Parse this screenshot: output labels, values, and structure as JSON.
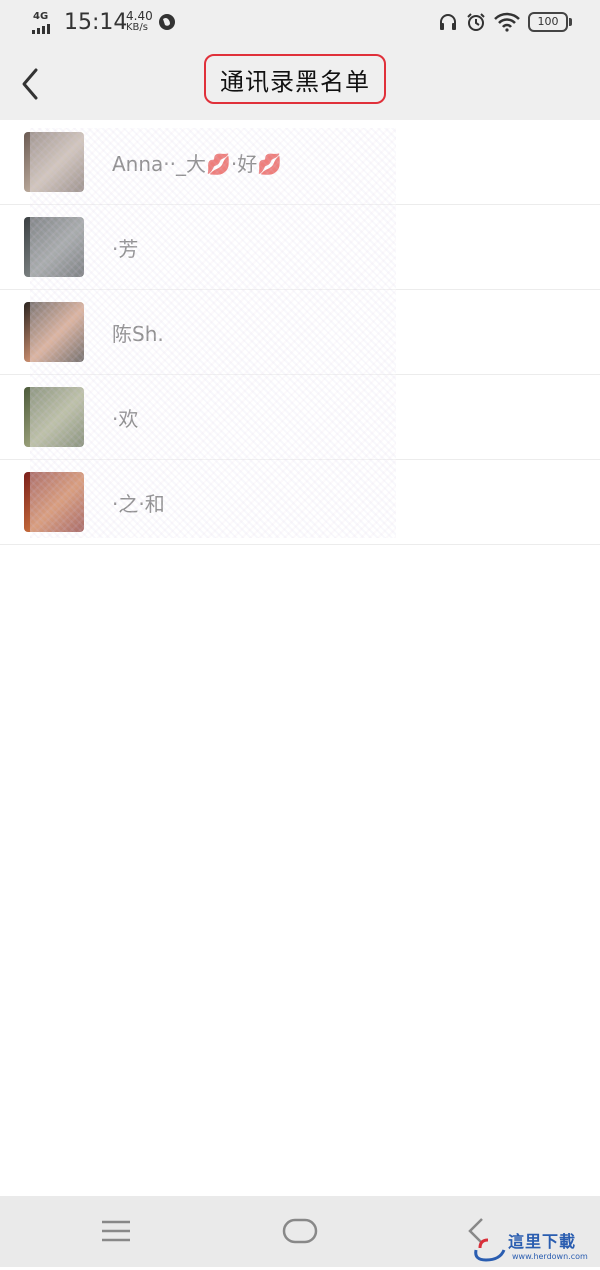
{
  "status_bar": {
    "network": "4G",
    "time": "15:14",
    "speed_value": "4.40",
    "speed_unit": "KB/s",
    "battery": "100",
    "icons": [
      "headphones-icon",
      "alarm-icon",
      "wifi-icon",
      "battery-icon",
      "globe-icon"
    ]
  },
  "header": {
    "title": "通讯录黑名单",
    "highlight_color": "#e0303a"
  },
  "contacts": [
    {
      "name": "Anna··_大💋·好💋",
      "avatar_colors": [
        "#6a5a52",
        "#b9a89a"
      ]
    },
    {
      "name": "·芳",
      "avatar_colors": [
        "#3a3f42",
        "#7a8080"
      ]
    },
    {
      "name": "陈Sh.",
      "avatar_colors": [
        "#2a2420",
        "#c98d6e"
      ]
    },
    {
      "name": "·欢",
      "avatar_colors": [
        "#4c5a3a",
        "#9aa07a"
      ]
    },
    {
      "name": "·之·和",
      "avatar_colors": [
        "#7a1e1a",
        "#c46a3a"
      ]
    }
  ],
  "watermark": {
    "text": "這里下載",
    "url": "www.herdown.com",
    "color": "#2a5db0"
  }
}
